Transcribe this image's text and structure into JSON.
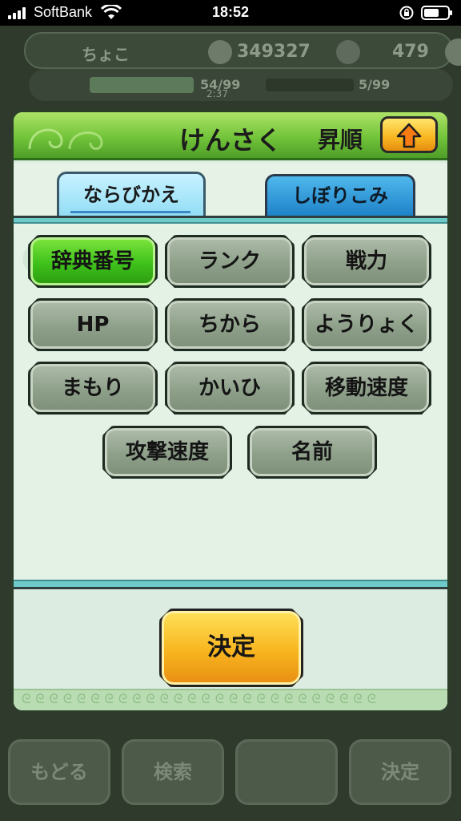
{
  "status_bar": {
    "carrier": "SoftBank",
    "time": "18:52"
  },
  "background": {
    "player_name": "ちょこ",
    "coins": "349327",
    "gems": "479",
    "stamina_1": "54/99",
    "stamina_2": "5/99",
    "timer": "2:37",
    "buttons": [
      "もどる",
      "検索",
      "",
      "決定"
    ]
  },
  "dialog": {
    "title": "けんさく",
    "order_label": "昇順",
    "order_icon": "up-arrow-icon",
    "tabs": [
      {
        "label": "ならびかえ",
        "active": true
      },
      {
        "label": "しぼりこみ",
        "active": false
      }
    ],
    "sort_options": [
      {
        "label": "辞典番号",
        "selected": true
      },
      {
        "label": "ランク",
        "selected": false
      },
      {
        "label": "戦力",
        "selected": false
      },
      {
        "label": "HP",
        "selected": false
      },
      {
        "label": "ちから",
        "selected": false
      },
      {
        "label": "ようりょく",
        "selected": false
      },
      {
        "label": "まもり",
        "selected": false
      },
      {
        "label": "かいひ",
        "selected": false
      },
      {
        "label": "移動速度",
        "selected": false
      },
      {
        "label": "攻撃速度",
        "selected": false
      },
      {
        "label": "名前",
        "selected": false
      }
    ],
    "confirm_label": "決定"
  },
  "colors": {
    "header_green": "#72c43a",
    "selected_green": "#3fc11b",
    "button_gray": "#8ea08a",
    "confirm_yellow": "#f8b51f",
    "tab_active": "#8fdcf5",
    "tab_inactive": "#1f82c8"
  }
}
